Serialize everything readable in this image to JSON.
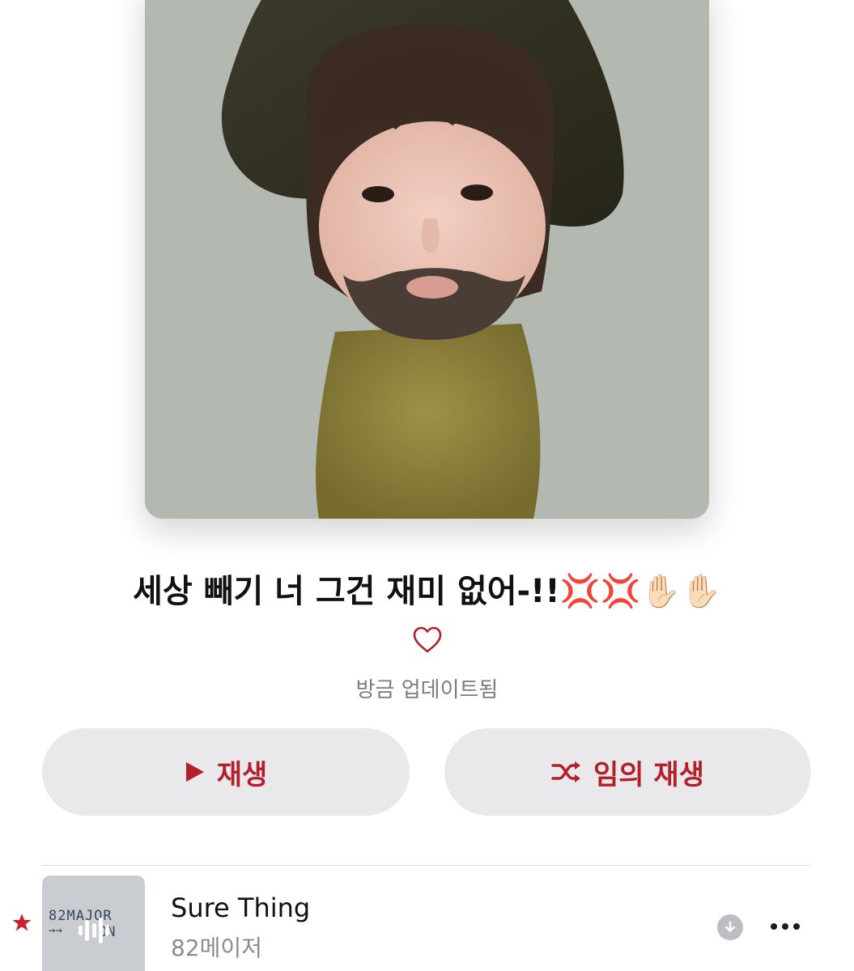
{
  "playlist": {
    "title": "세상 빼기 너 그건 재미 없어-!!",
    "title_emoji": "💢💢✋🏻✋🏻",
    "updated_label": "방금 업데이트됨"
  },
  "actions": {
    "play_label": "재생",
    "shuffle_label": "임의 재생"
  },
  "tracks": [
    {
      "title": "Sure Thing",
      "artist": "82메이저",
      "album_art_text": [
        "82MAJOR",
        "→→",
        "ON"
      ],
      "favorited_icon": "star-icon",
      "now_playing_icon": "equalizer-bars-icon",
      "download_icon": "download-arrow-icon",
      "more_icon": "ellipsis-icon"
    }
  ],
  "colors": {
    "accent": "#b3202a",
    "button_bg": "#e9e9ec",
    "secondary_text": "#7b7b80"
  }
}
